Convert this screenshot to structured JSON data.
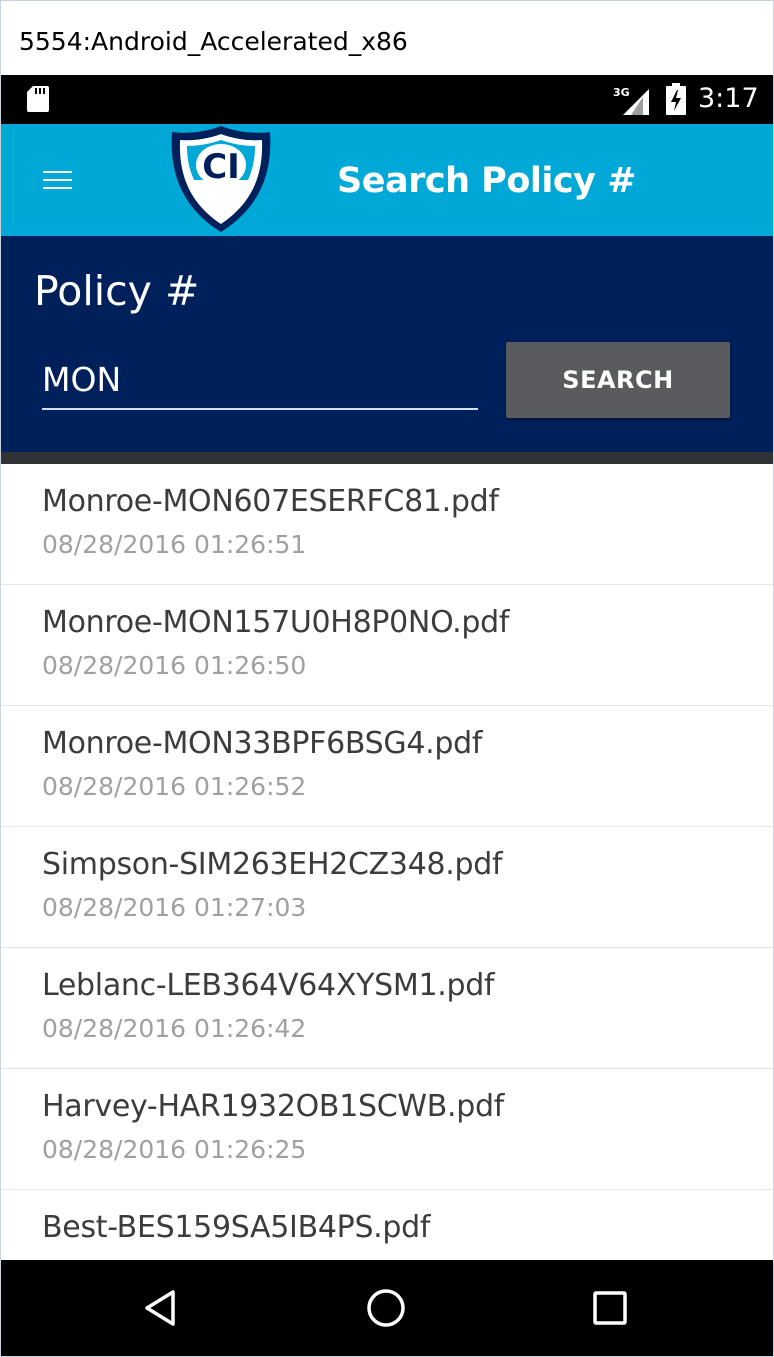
{
  "window": {
    "title": "5554:Android_Accelerated_x86"
  },
  "status_bar": {
    "time": "3:17",
    "network": "3G",
    "icons": [
      "sd-card-icon",
      "signal-3g-icon",
      "battery-charging-icon"
    ]
  },
  "app_bar": {
    "title": "Search Policy #",
    "menu_icon": "hamburger-menu-icon",
    "logo_text": "CI"
  },
  "search": {
    "label": "Policy #",
    "input_value": "MON",
    "button_label": "SEARCH"
  },
  "results": [
    {
      "name": "Monroe-MON607ESERFC81.pdf",
      "date": "08/28/2016 01:26:51"
    },
    {
      "name": "Monroe-MON157U0H8P0NO.pdf",
      "date": "08/28/2016 01:26:50"
    },
    {
      "name": "Monroe-MON33BPF6BSG4.pdf",
      "date": "08/28/2016 01:26:52"
    },
    {
      "name": "Simpson-SIM263EH2CZ348.pdf",
      "date": "08/28/2016 01:27:03"
    },
    {
      "name": "Leblanc-LEB364V64XYSM1.pdf",
      "date": "08/28/2016 01:26:42"
    },
    {
      "name": "Harvey-HAR1932OB1SCWB.pdf",
      "date": "08/28/2016 01:26:25"
    },
    {
      "name": "Best-BES159SA5IB4PS.pdf",
      "date": ""
    }
  ],
  "nav_bar": {
    "buttons": [
      "back-icon",
      "home-icon",
      "recents-icon"
    ]
  },
  "colors": {
    "app_bar": "#00a8d8",
    "search_panel": "#00205b",
    "search_button": "#5a5b5f",
    "result_title": "#3c3c3c",
    "result_date": "#a0a0a0"
  }
}
